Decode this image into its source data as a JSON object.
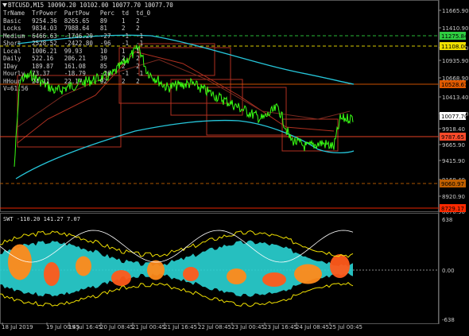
{
  "window": {
    "title": "BTCUSD,M15  10090.20 10102.00 10077.70 10077.70"
  },
  "stats_table": {
    "headers": [
      "TrName",
      "TrPower",
      "PartPow",
      "Perc",
      "td",
      "td_0"
    ],
    "rows": [
      [
        "Basic",
        "9254.36",
        "8265.65",
        "89",
        "1",
        "2"
      ],
      [
        "Locks",
        "9834.03",
        "7988.64",
        "81",
        "2",
        "2"
      ],
      [
        "Medium",
        "6466.63",
        "-1746.29",
        "-27",
        "-1",
        "-1"
      ],
      [
        "Short",
        "2528.52",
        "-2422.80",
        "-96",
        "-1",
        "-1"
      ],
      [
        "Local",
        "1006.21",
        "99.93",
        "10",
        "1",
        "1"
      ],
      [
        "Daily",
        "522.16",
        "206.21",
        "39",
        "2",
        "2"
      ],
      [
        "IDay",
        "189.87",
        "161.08",
        "85",
        "2",
        "2"
      ],
      [
        "Hourly",
        "73.37",
        "-18.79",
        "-26",
        "-1",
        "-1"
      ],
      [
        "HHour",
        "24.11",
        "22.17",
        "92",
        "2",
        "2"
      ]
    ],
    "extra": "V=61.56"
  },
  "price_axis": {
    "labels": [
      "11665.90",
      "11410.90",
      "11160.00",
      "10935.90",
      "10668.90",
      "10413.40",
      "10165.90",
      "9918.40",
      "9665.90",
      "9415.90",
      "9168.40",
      "8920.90",
      "8670.90"
    ],
    "badges": [
      {
        "text": "11275.84",
        "color": "#2ecc40"
      },
      {
        "text": "11108.00",
        "color": "#f0e000"
      },
      {
        "text": "10528.67",
        "color": "#e05a00"
      },
      {
        "text": "10077.70",
        "color": "#ffffff"
      },
      {
        "text": "9787.65",
        "color": "#ff4a2a"
      },
      {
        "text": "9060.97",
        "color": "#c06000"
      },
      {
        "text": "8729.17",
        "color": "#ff2a00"
      }
    ]
  },
  "indicator": {
    "title": "SWT -110.20 141.27 7.07",
    "axis_labels": [
      "638",
      "0.00",
      "-638"
    ]
  },
  "time_axis": {
    "labels": [
      "18 Jul 2019",
      "19 Jul 00:45",
      "19 Jul 16:45",
      "20 Jul 08:45",
      "21 Jul 00:45",
      "21 Jul 16:45",
      "22 Jul 08:45",
      "23 Jul 00:45",
      "23 Jul 16:45",
      "24 Jul 08:45",
      "25 Jul 00:45"
    ]
  },
  "colors": {
    "price_line": "#39ff14",
    "ma_cyan": "#26c6da",
    "channel": "#b03020",
    "grid": "#2a2a2a"
  }
}
